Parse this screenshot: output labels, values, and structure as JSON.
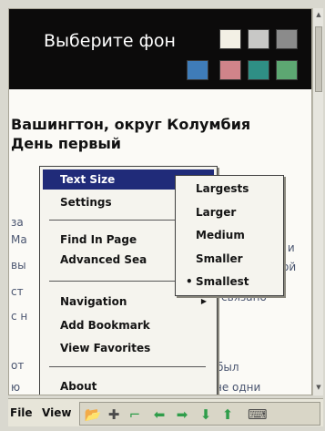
{
  "chooser": {
    "title": "Выберите фон",
    "swatches": [
      "#f3f0e5",
      "#c8c8c6",
      "#8b8b8b",
      "#3f7cb8",
      "#d0848a",
      "#2f8f85",
      "#5da772"
    ]
  },
  "article": {
    "headline_line1": "Вашингтон, округ Колумбия",
    "headline_line2": "День первый",
    "frag_1": "за",
    "frag_2": "Ма",
    "frag_3": "вы",
    "frag_4": "ст",
    "frag_5": "с н",
    "frag_6": "от",
    "frag_7": "ю",
    "frag_8": "у и",
    "frag_9": "ой",
    "frag_10": "я связано",
    "frag_11": "был",
    "frag_12": "не одни"
  },
  "menu": {
    "text_size": "Text Size",
    "settings": "Settings",
    "find": "Find In Page",
    "advanced": "Advanced Sea",
    "navigation": "Navigation",
    "add_bookmark": "Add Bookmark",
    "view_favorites": "View Favorites",
    "about": "About",
    "submenu_arrow": "▶"
  },
  "submenu": {
    "largest": "Largests",
    "larger": "Larger",
    "medium": "Medium",
    "smaller": "Smaller",
    "smallest": "Smallest",
    "selected_bullet": "•"
  },
  "bottom": {
    "file": "File",
    "view": "View"
  },
  "toolbar": {
    "folder": "📂",
    "plus": "✚",
    "phone": "⌐",
    "left": "⬅",
    "right": "➡",
    "down": "⬇",
    "up": "⬆",
    "keyboard": "⌨"
  },
  "scrollbar": {
    "up": "▲",
    "down": "▼"
  }
}
